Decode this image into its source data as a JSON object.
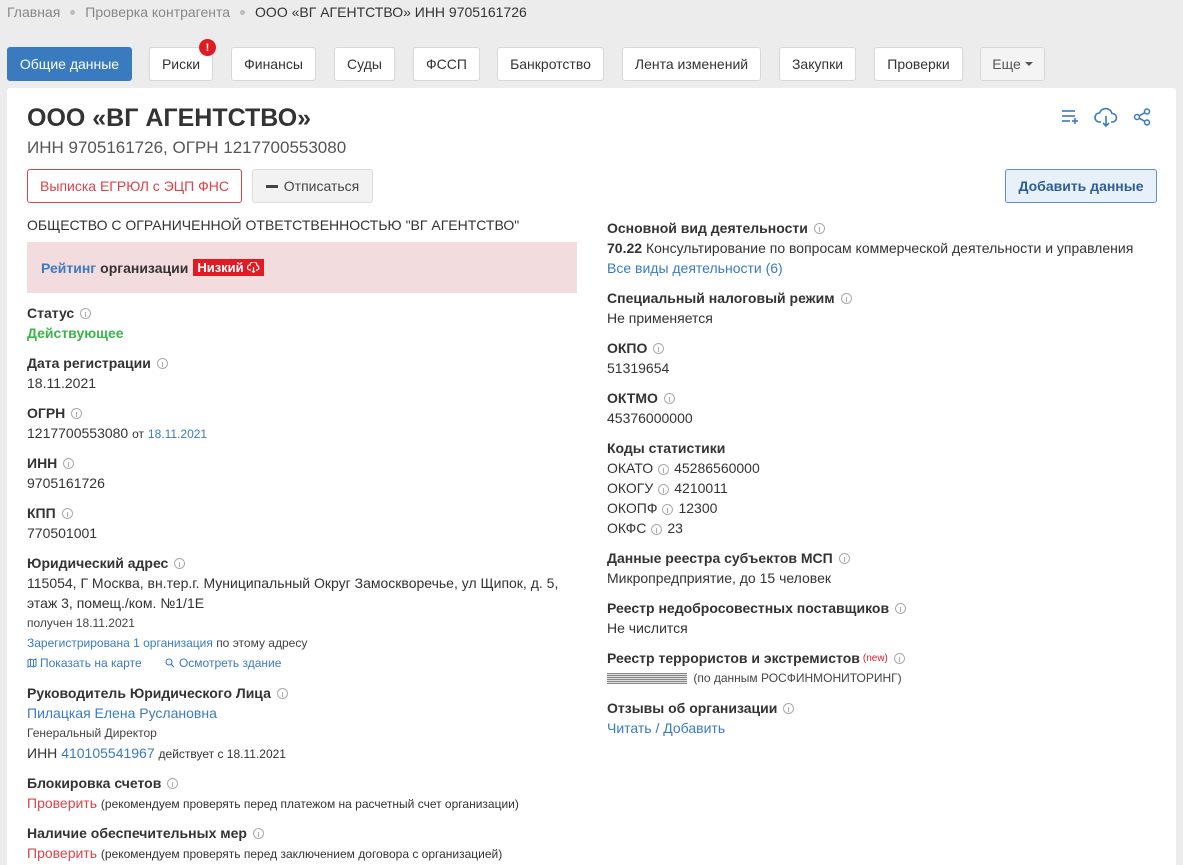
{
  "breadcrumb": [
    "Главная",
    "Проверка контрагента",
    "ООО «ВГ АГЕНТСТВО» ИНН 9705161726"
  ],
  "tabs": [
    "Общие данные",
    "Риски",
    "Финансы",
    "Суды",
    "ФССП",
    "Банкротство",
    "Лента изменений",
    "Закупки",
    "Проверки",
    "Еще"
  ],
  "risk_badge": "!",
  "company": {
    "title": "ООО «ВГ АГЕНТСТВО»",
    "ids": "ИНН 9705161726, ОГРН 1217700553080",
    "full_name": "ОБЩЕСТВО С ОГРАНИЧЕННОЙ ОТВЕТСТВЕННОСТЬЮ \"ВГ АГЕНТСТВО\""
  },
  "buttons": {
    "egrul": "Выписка ЕГРЮЛ с ЭЦП ФНС",
    "unsubscribe": "Отписаться",
    "add_data": "Добавить данные"
  },
  "rating": {
    "word": "Рейтинг",
    "text": "организации",
    "level": "Низкий"
  },
  "left": {
    "status_label": "Статус",
    "status_value": "Действующее",
    "reg_label": "Дата регистрации",
    "reg_value": "18.11.2021",
    "ogrn_label": "ОГРН",
    "ogrn_value": "1217700553080",
    "ogrn_from": "от",
    "ogrn_date": "18.11.2021",
    "inn_label": "ИНН",
    "inn_value": "9705161726",
    "kpp_label": "КПП",
    "kpp_value": "770501001",
    "addr_label": "Юридический адрес",
    "addr_line1": "115054, Г Москва, вн.тер.г. Муниципальный Округ Замоскворечье, ул Щипок, д. 5,",
    "addr_line2": "этаж 3, помещ./ком. №1/1Е",
    "addr_received": "получен 18.11.2021",
    "addr_registered_link": "Зарегистрирована 1 организация",
    "addr_registered_rest": "по этому адресу",
    "show_map": "Показать на карте",
    "view_building": "Осмотреть здание",
    "head_label": "Руководитель Юридического Лица",
    "head_name": "Пилацкая Елена Руслановна",
    "head_position": "Генеральный Директор",
    "head_inn_prefix": "ИНН",
    "head_inn": "410105541967",
    "head_since": "действует с 18.11.2021",
    "block_label": "Блокировка счетов",
    "block_link": "Проверить",
    "block_note": "(рекомендуем проверять перед платежом на расчетный счет организации)",
    "secure_label": "Наличие обеспечительных мер",
    "secure_link": "Проверить",
    "secure_note": "(рекомендуем проверять перед заключением договора с организацией)"
  },
  "right": {
    "activity_label": "Основной вид деятельности",
    "activity_code": "70.22",
    "activity_text": "Консультирование по вопросам коммерческой деятельности и управления",
    "all_activities": "Все виды деятельности (6)",
    "tax_label": "Специальный налоговый режим",
    "tax_value": "Не применяется",
    "okpo_label": "ОКПО",
    "okpo_value": "51319654",
    "oktmo_label": "ОКТМО",
    "oktmo_value": "45376000000",
    "stat_label": "Коды статистики",
    "okato_label": "ОКАТО",
    "okato_value": "45286560000",
    "okogu_label": "ОКОГУ",
    "okogu_value": "4210011",
    "okopf_label": "ОКОПФ",
    "okopf_value": "12300",
    "okfs_label": "ОКФС",
    "okfs_value": "23",
    "msp_label": "Данные реестра субъектов МСП",
    "msp_value": "Микропредприятие, до 15 человек",
    "rnp_label": "Реестр недобросовестных поставщиков",
    "rnp_value": "Не числится",
    "terror_label": "Реестр террористов и экстремистов",
    "terror_new": "(new)",
    "terror_note": "(по данным РОСФИНМОНИТОРИНГ)",
    "reviews_label": "Отзывы об организации",
    "reviews_link": "Читать / Добавить"
  },
  "colors": {
    "accent": "#3a7bbf",
    "danger": "#e01b24",
    "success": "#3cb44a"
  },
  "icons": [
    "list-add-icon",
    "cloud-download-icon",
    "share-icon",
    "map-icon",
    "search-icon",
    "info-icon"
  ]
}
